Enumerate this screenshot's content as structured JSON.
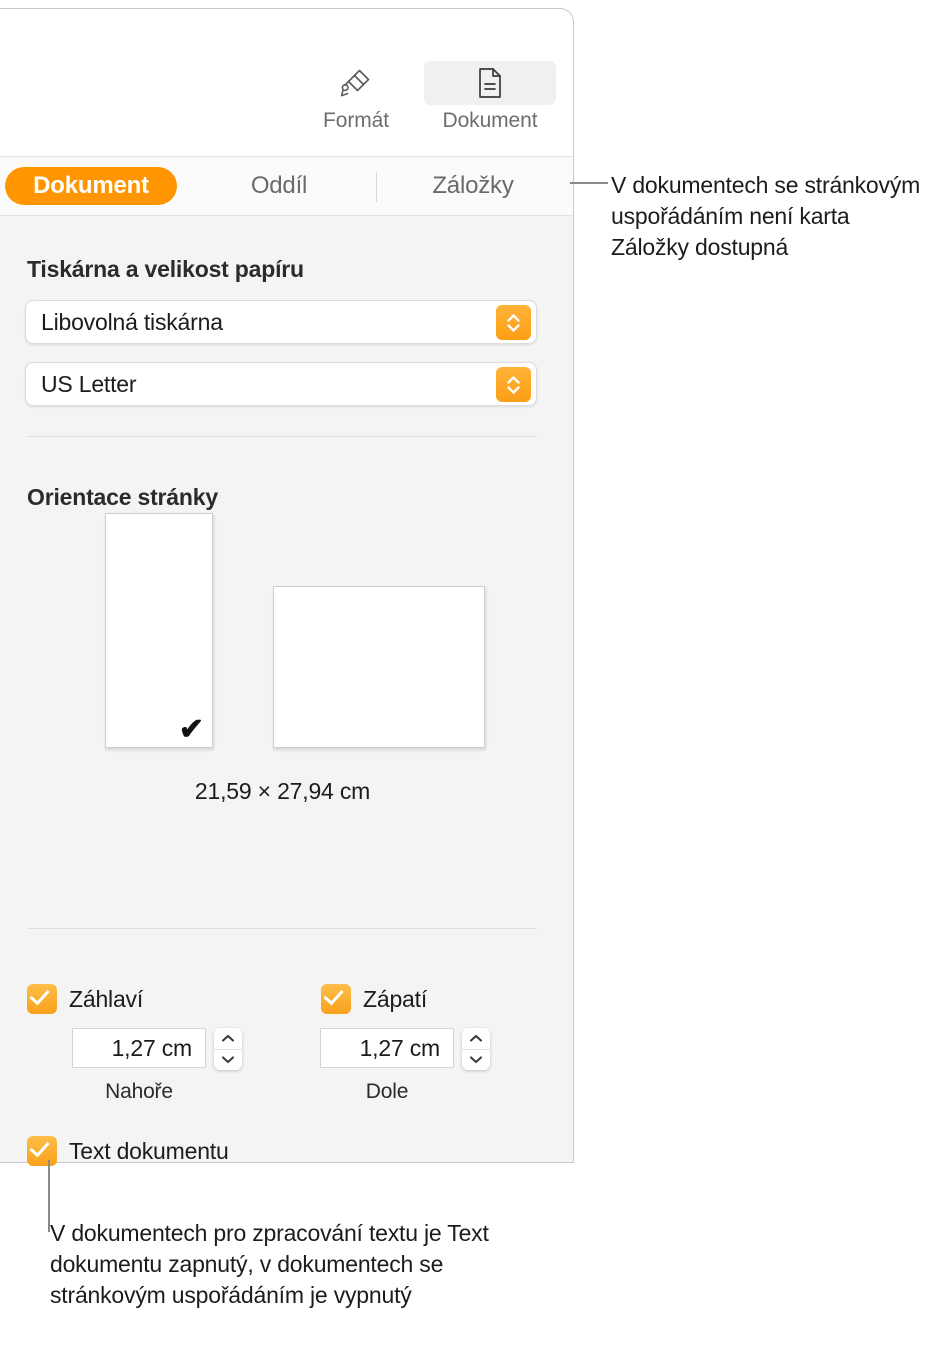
{
  "toolbar": {
    "items": [
      {
        "icon": "paintbrush-icon",
        "label": "Formát",
        "active": false
      },
      {
        "icon": "document-icon",
        "label": "Dokument",
        "active": true
      }
    ],
    "format_label": "Formát",
    "document_label": "Dokument"
  },
  "tabs": {
    "dokument": "Dokument",
    "oddil": "Oddíl",
    "zalozky": "Záložky",
    "selected": "Dokument"
  },
  "sections": {
    "printer": {
      "title": "Tiskárna a velikost papíru",
      "printer_value": "Libovolná tiskárna",
      "paper_size_value": "US Letter"
    },
    "orientation": {
      "title": "Orientace stránky",
      "selected": "portrait",
      "dimensions": "21,59 × 27,94 cm"
    },
    "margins": {
      "header": {
        "label": "Záhlaví",
        "checked": true,
        "value": "1,27 cm",
        "sub_label": "Nahoře"
      },
      "footer": {
        "label": "Zápatí",
        "checked": true,
        "value": "1,27 cm",
        "sub_label": "Dole"
      },
      "body_text": {
        "label": "Text dokumentu",
        "checked": true
      }
    }
  },
  "callouts": {
    "top": "V dokumentech se stránkovým uspořádáním není karta Záložky dostupná",
    "bottom": "V dokumentech pro zpracování textu je Text dokumentu zapnutý, v dokumentech se stránkovým uspořádáním je vypnutý"
  },
  "colors": {
    "accent_orange": "#FF9500",
    "control_amber": "#FBA91D",
    "panel_background": "#F4F4F4",
    "text_primary": "#1C1C1C",
    "text_secondary": "#6A6A6A"
  }
}
